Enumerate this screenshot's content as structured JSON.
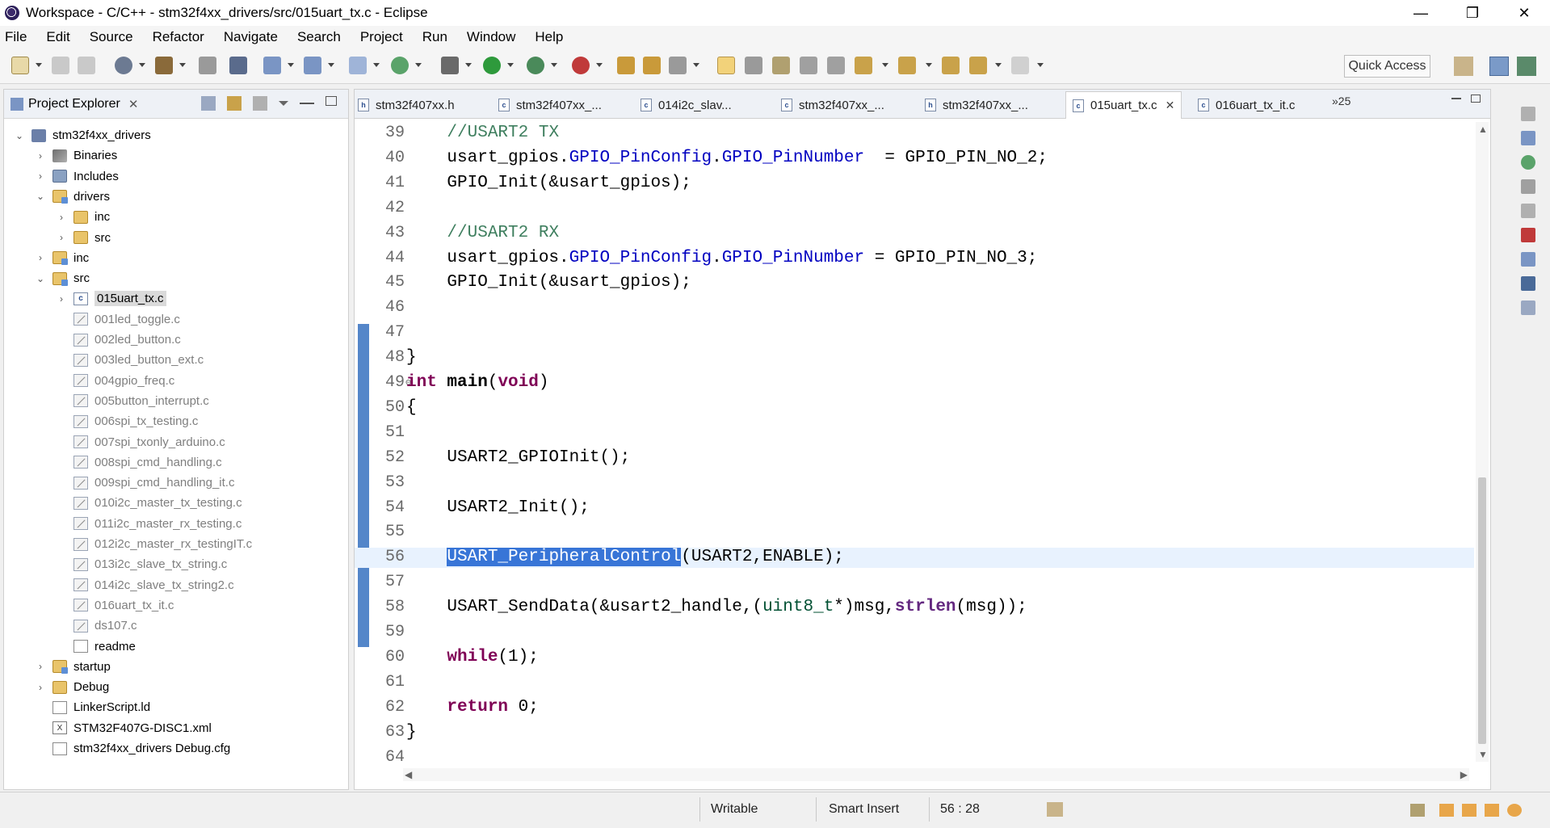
{
  "window": {
    "title": "Workspace - C/C++ - stm32f4xx_drivers/src/015uart_tx.c - Eclipse",
    "controls": [
      "—",
      "❐",
      "✕"
    ]
  },
  "menu": [
    "File",
    "Edit",
    "Source",
    "Refactor",
    "Navigate",
    "Search",
    "Project",
    "Run",
    "Window",
    "Help"
  ],
  "toolbar": {
    "quick_access": "Quick Access"
  },
  "project_explorer": {
    "title": "Project Explorer",
    "tree": [
      {
        "label": "stm32f4xx_drivers",
        "depth": 0,
        "chev": "⌄",
        "icon": "proj"
      },
      {
        "label": "Binaries",
        "depth": 1,
        "chev": "›",
        "icon": "bin"
      },
      {
        "label": "Includes",
        "depth": 1,
        "chev": "›",
        "icon": "inc"
      },
      {
        "label": "drivers",
        "depth": 1,
        "chev": "⌄",
        "icon": "folder-src"
      },
      {
        "label": "inc",
        "depth": 2,
        "chev": "›",
        "icon": "folder"
      },
      {
        "label": "src",
        "depth": 2,
        "chev": "›",
        "icon": "folder"
      },
      {
        "label": "inc",
        "depth": 1,
        "chev": "›",
        "icon": "folder-src"
      },
      {
        "label": "src",
        "depth": 1,
        "chev": "⌄",
        "icon": "folder-src"
      },
      {
        "label": "015uart_tx.c",
        "depth": 2,
        "chev": "›",
        "icon": "cfile",
        "selected": true
      },
      {
        "label": "001led_toggle.c",
        "depth": 2,
        "chev": "",
        "icon": "excl",
        "dim": true
      },
      {
        "label": "002led_button.c",
        "depth": 2,
        "chev": "",
        "icon": "excl",
        "dim": true
      },
      {
        "label": "003led_button_ext.c",
        "depth": 2,
        "chev": "",
        "icon": "excl",
        "dim": true
      },
      {
        "label": "004gpio_freq.c",
        "depth": 2,
        "chev": "",
        "icon": "excl",
        "dim": true
      },
      {
        "label": "005button_interrupt.c",
        "depth": 2,
        "chev": "",
        "icon": "excl",
        "dim": true
      },
      {
        "label": "006spi_tx_testing.c",
        "depth": 2,
        "chev": "",
        "icon": "excl",
        "dim": true
      },
      {
        "label": "007spi_txonly_arduino.c",
        "depth": 2,
        "chev": "",
        "icon": "excl",
        "dim": true
      },
      {
        "label": "008spi_cmd_handling.c",
        "depth": 2,
        "chev": "",
        "icon": "excl",
        "dim": true
      },
      {
        "label": "009spi_cmd_handling_it.c",
        "depth": 2,
        "chev": "",
        "icon": "excl",
        "dim": true
      },
      {
        "label": "010i2c_master_tx_testing.c",
        "depth": 2,
        "chev": "",
        "icon": "excl",
        "dim": true
      },
      {
        "label": "011i2c_master_rx_testing.c",
        "depth": 2,
        "chev": "",
        "icon": "excl",
        "dim": true
      },
      {
        "label": "012i2c_master_rx_testingIT.c",
        "depth": 2,
        "chev": "",
        "icon": "excl",
        "dim": true
      },
      {
        "label": "013i2c_slave_tx_string.c",
        "depth": 2,
        "chev": "",
        "icon": "excl",
        "dim": true
      },
      {
        "label": "014i2c_slave_tx_string2.c",
        "depth": 2,
        "chev": "",
        "icon": "excl",
        "dim": true
      },
      {
        "label": "016uart_tx_it.c",
        "depth": 2,
        "chev": "",
        "icon": "excl",
        "dim": true
      },
      {
        "label": "ds107.c",
        "depth": 2,
        "chev": "",
        "icon": "excl",
        "dim": true
      },
      {
        "label": "readme",
        "depth": 2,
        "chev": "",
        "icon": "doc"
      },
      {
        "label": "startup",
        "depth": 1,
        "chev": "›",
        "icon": "folder-src"
      },
      {
        "label": "Debug",
        "depth": 1,
        "chev": "›",
        "icon": "folder"
      },
      {
        "label": "LinkerScript.ld",
        "depth": 1,
        "chev": "",
        "icon": "doc"
      },
      {
        "label": "STM32F407G-DISC1.xml",
        "depth": 1,
        "chev": "",
        "icon": "xml"
      },
      {
        "label": "stm32f4xx_drivers Debug.cfg",
        "depth": 1,
        "chev": "",
        "icon": "cfg"
      }
    ]
  },
  "editor": {
    "tabs": [
      {
        "label": "stm32f407xx.h",
        "icon": "h"
      },
      {
        "label": "stm32f407xx_...",
        "icon": "c"
      },
      {
        "label": "014i2c_slav...",
        "icon": "c"
      },
      {
        "label": "stm32f407xx_...",
        "icon": "c"
      },
      {
        "label": "stm32f407xx_...",
        "icon": "h"
      },
      {
        "label": "015uart_tx.c",
        "icon": "c",
        "active": true
      },
      {
        "label": "016uart_tx_it.c",
        "icon": "c"
      }
    ],
    "more_tabs": "»25",
    "lines": [
      {
        "n": "39",
        "html": "    <span class='comment'>//USART2 TX</span>"
      },
      {
        "n": "40",
        "html": "    usart_gpios.<span class='field'>GPIO_PinConfig</span>.<span class='field'>GPIO_PinNumber</span>  = GPIO_PIN_NO_2;"
      },
      {
        "n": "41",
        "html": "    GPIO_Init(&amp;usart_gpios);"
      },
      {
        "n": "42",
        "html": ""
      },
      {
        "n": "43",
        "html": "    <span class='comment'>//USART2 RX</span>"
      },
      {
        "n": "44",
        "html": "    usart_gpios.<span class='field'>GPIO_PinConfig</span>.<span class='field'>GPIO_PinNumber</span> = GPIO_PIN_NO_3;"
      },
      {
        "n": "45",
        "html": "    GPIO_Init(&amp;usart_gpios);"
      },
      {
        "n": "46",
        "html": ""
      },
      {
        "n": "47",
        "html": ""
      },
      {
        "n": "48",
        "html": "}"
      },
      {
        "n": "49",
        "html": "<span class='kw'>int</span> <span class='fn-bold'>main</span>(<span class='kw'>void</span>)",
        "fold": true
      },
      {
        "n": "50",
        "html": "{"
      },
      {
        "n": "51",
        "html": ""
      },
      {
        "n": "52",
        "html": "    USART2_GPIOInit();"
      },
      {
        "n": "53",
        "html": ""
      },
      {
        "n": "54",
        "html": "    USART2_Init();"
      },
      {
        "n": "55",
        "html": ""
      },
      {
        "n": "56",
        "html": "    <span class='hl'>USART_PeripheralControl</span>(USART2,ENABLE);",
        "current": true
      },
      {
        "n": "57",
        "html": ""
      },
      {
        "n": "58",
        "html": "    USART_SendData(&amp;usart2_handle,(<span class='type'>uint8_t</span>*)msg,<span class='fnm'>strlen</span>(msg));"
      },
      {
        "n": "59",
        "html": ""
      },
      {
        "n": "60",
        "html": "    <span class='kw'>while</span>(1);"
      },
      {
        "n": "61",
        "html": ""
      },
      {
        "n": "62",
        "html": "    <span class='kw'>return</span> 0;"
      },
      {
        "n": "63",
        "html": "}"
      },
      {
        "n": "64",
        "html": ""
      }
    ]
  },
  "status": {
    "writable": "Writable",
    "insert_mode": "Smart Insert",
    "position": "56 : 28"
  },
  "colors": {
    "selection": "#3875d7",
    "keyword": "#7f0055",
    "comment": "#3f7f5f",
    "field": "#0000c0"
  }
}
